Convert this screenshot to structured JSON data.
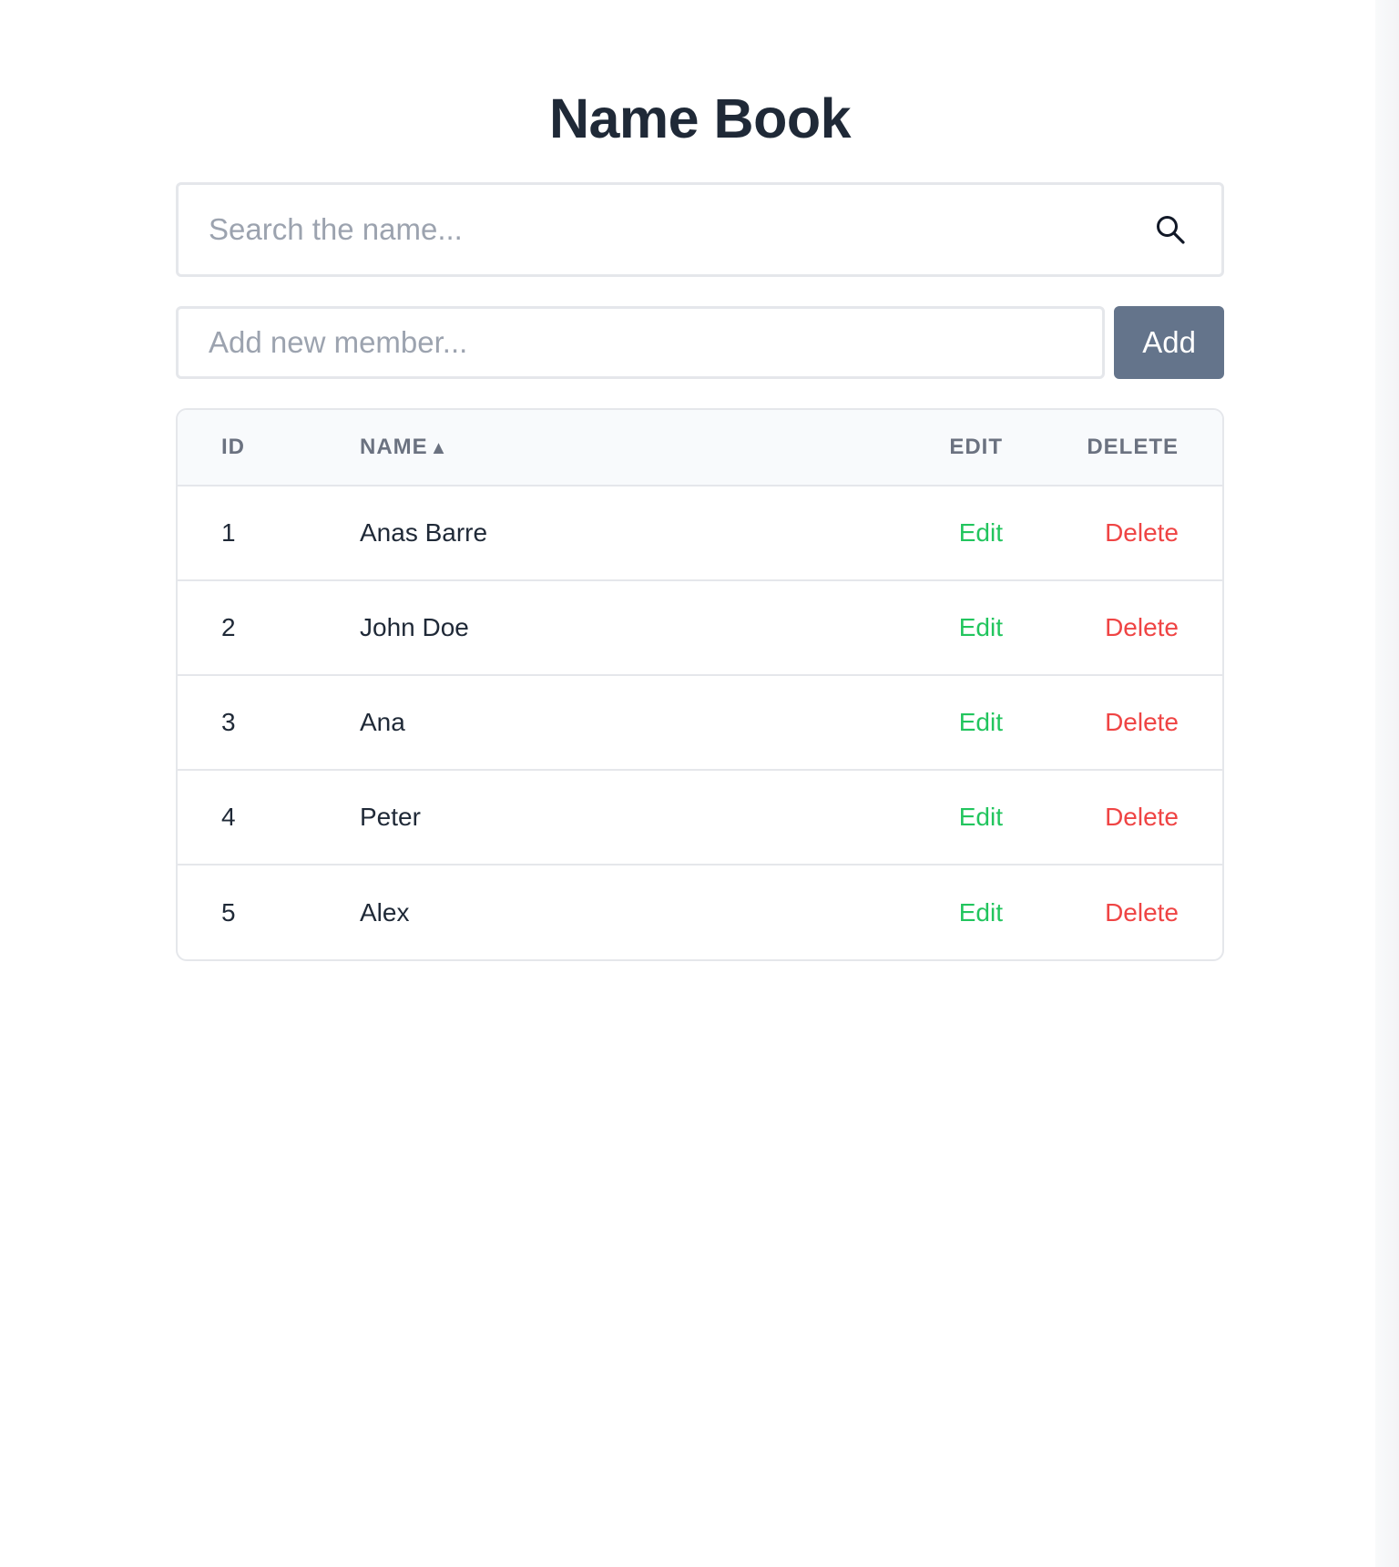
{
  "title": "Name Book",
  "search": {
    "placeholder": "Search the name...",
    "value": ""
  },
  "add_member": {
    "placeholder": "Add new member...",
    "value": "",
    "button_label": "Add"
  },
  "table": {
    "headers": {
      "id": "ID",
      "name": "NAME",
      "sort_indicator": "▲",
      "edit": "EDIT",
      "delete": "DELETE"
    },
    "rows": [
      {
        "id": "1",
        "name": "Anas Barre",
        "edit": "Edit",
        "delete": "Delete"
      },
      {
        "id": "2",
        "name": "John Doe",
        "edit": "Edit",
        "delete": "Delete"
      },
      {
        "id": "3",
        "name": "Ana",
        "edit": "Edit",
        "delete": "Delete"
      },
      {
        "id": "4",
        "name": "Peter",
        "edit": "Edit",
        "delete": "Delete"
      },
      {
        "id": "5",
        "name": "Alex",
        "edit": "Edit",
        "delete": "Delete"
      }
    ]
  },
  "colors": {
    "edit": "#22c55e",
    "delete": "#ef4444",
    "add_button": "#64748b",
    "header_bg": "#f8fafc"
  },
  "icons": {
    "search": "search-icon"
  }
}
